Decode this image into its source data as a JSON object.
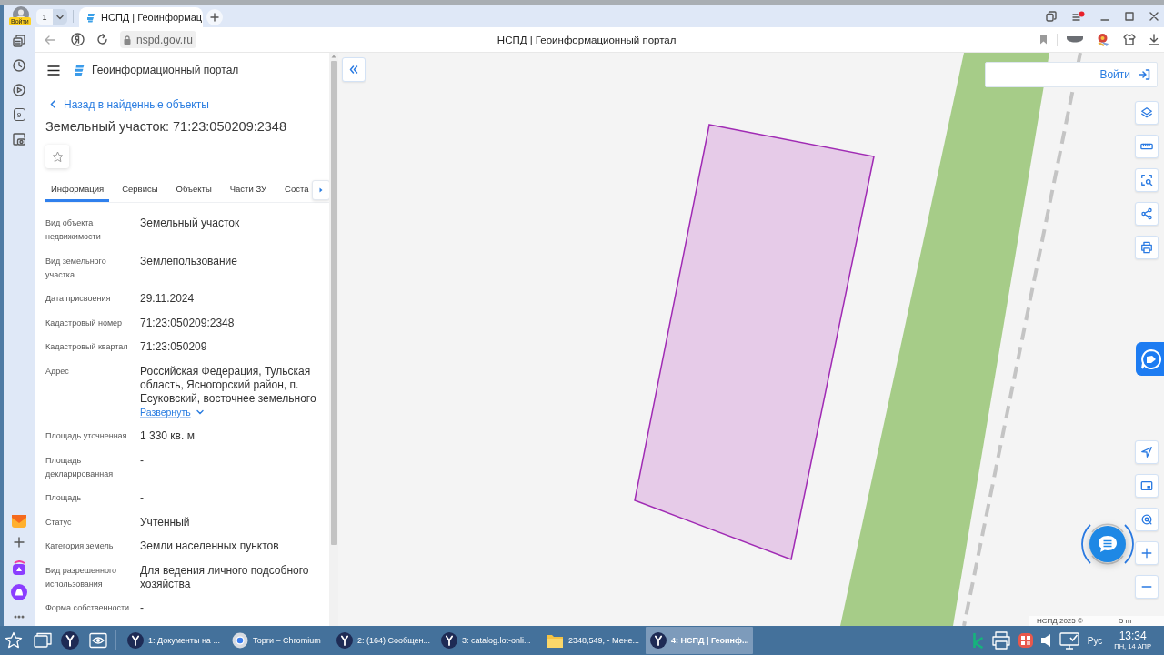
{
  "browser": {
    "profile_badge": "Войти",
    "tab_count": "1",
    "tabs": [
      {
        "title": "НСПД | Геоинформац",
        "selected": true
      }
    ],
    "url": "nspd.gov.ru",
    "page_title": "НСПД | Геоинформационный портал"
  },
  "browser_sidebar": {
    "app_badge": "9"
  },
  "panel": {
    "portal_name": "Геоинформационный портал",
    "back_link": "Назад в найденные объекты",
    "title": "Земельный участок: 71:23:050209:2348",
    "favorite": false,
    "tabs": [
      {
        "label": "Информация",
        "selected": true
      },
      {
        "label": "Сервисы",
        "selected": false
      },
      {
        "label": "Объекты",
        "selected": false
      },
      {
        "label": "Части ЗУ",
        "selected": false
      },
      {
        "label": "Соста",
        "selected": false
      }
    ],
    "properties": [
      {
        "label": "Вид объекта недвижимости",
        "value": "Земельный участок"
      },
      {
        "label": "Вид земельного участка",
        "value": "Землепользование"
      },
      {
        "label": "Дата присвоения",
        "value": "29.11.2024"
      },
      {
        "label": "Кадастровый номер",
        "value": "71:23:050209:2348"
      },
      {
        "label": "Кадастровый квартал",
        "value": "71:23:050209"
      },
      {
        "label": "Адрес",
        "value": "Российская Федерация, Тульская область, Ясногорский район, п. Есуковский, восточнее земельного",
        "expand_link": "Развернуть"
      },
      {
        "label": "Площадь уточненная",
        "value": "1 330 кв. м"
      },
      {
        "label": "Площадь декларированная",
        "value": "-"
      },
      {
        "label": "Площадь",
        "value": "-"
      },
      {
        "label": "Статус",
        "value": "Учтенный"
      },
      {
        "label": "Категория земель",
        "value": "Земли населенных пунктов"
      },
      {
        "label": "Вид разрешенного использования",
        "value": "Для ведения личного подсобного хозяйства"
      },
      {
        "label": "Форма собственности",
        "value": "-"
      }
    ]
  },
  "map": {
    "login_button": "Войти",
    "attribution": "НСПД 2025 ©",
    "scale": "5 m"
  },
  "taskbar": {
    "tasks": [
      {
        "label": "1: Документы на ...",
        "kind": "yandex",
        "selected": false
      },
      {
        "label": "Торги – Chromium",
        "kind": "chromium",
        "selected": false
      },
      {
        "label": "2: (164) Сообщен...",
        "kind": "yandex",
        "selected": false
      },
      {
        "label": "3: catalog.lot-onli...",
        "kind": "yandex",
        "selected": false
      },
      {
        "label": "2348,549, - Мене...",
        "kind": "folder",
        "selected": false
      },
      {
        "label": "4: НСПД | Геоинф...",
        "kind": "yandex",
        "selected": true
      }
    ],
    "language": "Рус",
    "time": "13:34",
    "date": "ПН, 14 АПР"
  }
}
